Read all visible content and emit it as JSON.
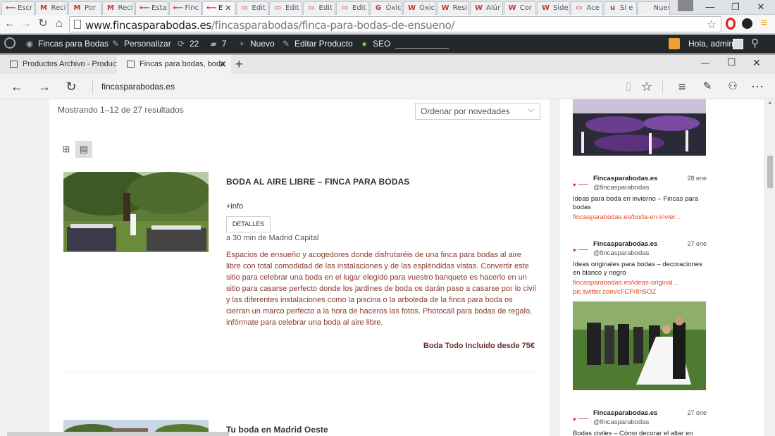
{
  "chrome": {
    "tabs": [
      {
        "icon": "⟵",
        "label": "Escr"
      },
      {
        "icon": "M",
        "label": "Reci"
      },
      {
        "icon": "M",
        "label": "Por"
      },
      {
        "icon": "M",
        "label": "Reci"
      },
      {
        "icon": "⟵",
        "label": "Esta"
      },
      {
        "icon": "⟵",
        "label": "Finc"
      },
      {
        "icon": "⟵",
        "label": "E"
      },
      {
        "icon": "▭",
        "label": "Edit"
      },
      {
        "icon": "▭",
        "label": "Edit"
      },
      {
        "icon": "▭",
        "label": "Edit"
      },
      {
        "icon": "▭",
        "label": "Edit"
      },
      {
        "icon": "G",
        "label": "Óxic"
      },
      {
        "icon": "W",
        "label": "Óxic"
      },
      {
        "icon": "W",
        "label": "Resi"
      },
      {
        "icon": "W",
        "label": "Alúr"
      },
      {
        "icon": "W",
        "label": "Cor"
      },
      {
        "icon": "W",
        "label": "Side"
      },
      {
        "icon": "▭",
        "label": "Ace"
      },
      {
        "icon": "u",
        "label": "Si e"
      },
      {
        "icon": "",
        "label": "Nueva"
      }
    ],
    "close_tab": "✕",
    "url_host": "www.fincasparabodas.es",
    "url_path": "/fincasparabodas/finca-para-bodas-de-ensueno/",
    "window_controls": {
      "minimize": "—",
      "restore": "❐",
      "close": "✕"
    }
  },
  "wpbar": {
    "site": "Fincas para Bodas",
    "customize": "Personalizar",
    "updates": "22",
    "comments": "7",
    "new": "Nuevo",
    "edit": "Editar Producto",
    "seo": "SEO",
    "greeting": "Hola, admin"
  },
  "edge": {
    "tabs": [
      {
        "label": "Productos Archivo - Product"
      },
      {
        "label": "Fincas para bodas, boda"
      }
    ],
    "new_tab": "+",
    "address": "fincasparabodas.es",
    "window_controls": {
      "minimize": "—",
      "maximize": "☐",
      "close": "✕"
    }
  },
  "shop": {
    "result_count": "Mostrando 1–12 de 27 resultados",
    "sort_selected": "Ordenar por novedades",
    "products": [
      {
        "title": "BODA AL AIRE LIBRE – FINCA PARA BODAS",
        "info_link": "+info",
        "details_button": "DETALLES",
        "location": "a 30 min de Madrid Capital",
        "description": "Espacios de ensueño y acogedores donde disfrutaréis de una finca para bodas al aire libre con total comodidad de las instalaciones y de las espléndidas vistas. Convertir este sitio para celebrar una boda en el lugar elegido para vuestro banquete es hacerlo en un sitio para casarse perfecto donde los jardines de boda os darán paso a casarse por lo civil y las diferentes instalaciones como la piscina o la arboleda de la finca para boda os cierran un marco perfecto a la hora de haceros las fotos. Photocall para bodas de regalo, infórmate para celebrar una boda al aire libre.",
        "price": "Boda Todo Incluido desde 75€"
      },
      {
        "title": "Tu boda en Madrid Oeste"
      }
    ]
  },
  "twitter": {
    "tweets": [
      {
        "name": "Fincasparabodas.es",
        "handle": "@fincasparabodas",
        "date": "28 ene",
        "text": "Ideas para boda en invierno – Fincas para bodas",
        "links": [
          "fincasparabodas.es/boda-en-invier..."
        ]
      },
      {
        "name": "Fincasparabodas.es",
        "handle": "@fincasparabodas",
        "date": "27 ene",
        "text": "Ideas originales para bodas – decoraciones en blanco y negro",
        "links": [
          "fincasparabodas.es/ideas-original...",
          "pic.twitter.com/cFCFr8n5OZ"
        ]
      },
      {
        "name": "Fincasparabodas.es",
        "handle": "@fincasparabodas",
        "date": "27 ene",
        "text": "Bodas civiles – Cómo decorar el altar en"
      }
    ]
  },
  "colors": {
    "wp_bar": "#23282d",
    "description_text": "#8a3a2a",
    "tweet_link": "#e04a2a",
    "price_text": "#6b2c2c"
  }
}
